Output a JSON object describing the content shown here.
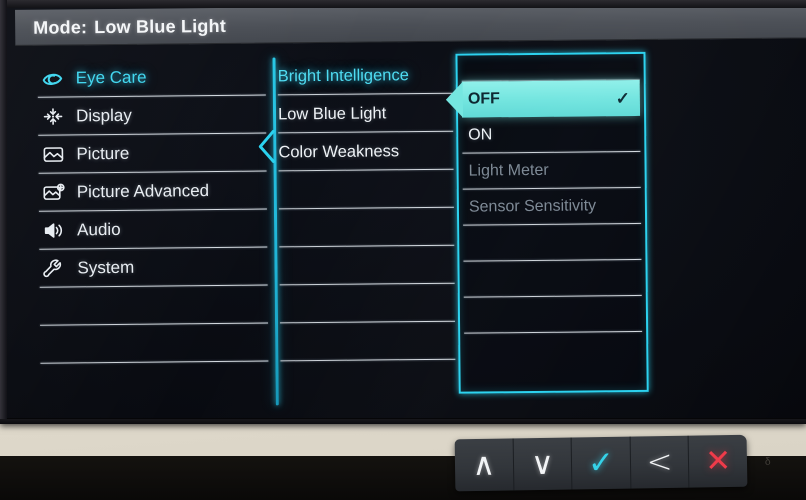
{
  "titlebar": {
    "mode_label": "Mode:",
    "mode_value": "Low Blue Light"
  },
  "colors": {
    "accent_cyan": "#2ad2ef",
    "highlight_cyan": "#74e6e0",
    "selected_text": "#3fd6ef",
    "text_primary": "#eef3f7",
    "text_disabled": "#7c8894",
    "danger_red": "#ef3b4a",
    "titlebar_bg": "#4b4f56",
    "screen_bg": "#080a10"
  },
  "sidebar": {
    "items": [
      {
        "label": "Eye Care",
        "icon": "eye-icon",
        "selected": true,
        "empty": false
      },
      {
        "label": "Display",
        "icon": "display-resize-icon",
        "selected": false,
        "empty": false
      },
      {
        "label": "Picture",
        "icon": "picture-icon",
        "selected": false,
        "empty": false
      },
      {
        "label": "Picture Advanced",
        "icon": "picture-advanced-icon",
        "selected": false,
        "empty": false
      },
      {
        "label": "Audio",
        "icon": "speaker-icon",
        "selected": false,
        "empty": false
      },
      {
        "label": "System",
        "icon": "wrench-icon",
        "selected": false,
        "empty": false
      },
      {
        "label": "",
        "icon": "",
        "selected": false,
        "empty": true
      },
      {
        "label": "",
        "icon": "",
        "selected": false,
        "empty": true
      }
    ]
  },
  "submenu": {
    "items": [
      {
        "label": "Bright Intelligence",
        "selected": true,
        "empty": false
      },
      {
        "label": "Low Blue Light",
        "selected": false,
        "empty": false
      },
      {
        "label": "Color Weakness",
        "selected": false,
        "empty": false
      },
      {
        "label": "",
        "selected": false,
        "empty": true
      },
      {
        "label": "",
        "selected": false,
        "empty": true
      },
      {
        "label": "",
        "selected": false,
        "empty": true
      },
      {
        "label": "",
        "selected": false,
        "empty": true
      },
      {
        "label": "",
        "selected": false,
        "empty": true
      }
    ]
  },
  "options_panel": {
    "items": [
      {
        "label": "OFF",
        "state": "highlight",
        "check": "✓"
      },
      {
        "label": "ON",
        "state": "normal",
        "check": ""
      },
      {
        "label": "Light Meter",
        "state": "disabled",
        "check": ""
      },
      {
        "label": "Sensor Sensitivity",
        "state": "disabled",
        "check": ""
      },
      {
        "label": "",
        "state": "empty",
        "check": ""
      },
      {
        "label": "",
        "state": "empty",
        "check": ""
      },
      {
        "label": "",
        "state": "empty",
        "check": ""
      }
    ]
  },
  "control_buttons": [
    {
      "name": "up-button",
      "glyph": "∧",
      "style": "plain"
    },
    {
      "name": "down-button",
      "glyph": "∨",
      "style": "plain"
    },
    {
      "name": "confirm-button",
      "glyph": "✓",
      "style": "accent"
    },
    {
      "name": "back-button",
      "glyph": "<",
      "style": "plain"
    },
    {
      "name": "exit-button",
      "glyph": "✕",
      "style": "danger"
    }
  ],
  "brandmark": {
    "glyph": "ᵟ"
  }
}
